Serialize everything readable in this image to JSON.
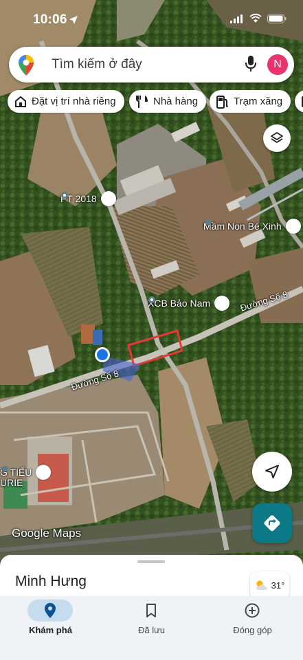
{
  "status_bar": {
    "time": "10:06"
  },
  "search": {
    "placeholder": "Tìm kiếm ở đây",
    "avatar_initial": "N"
  },
  "chips": [
    {
      "label": "Đặt vị trí nhà riêng",
      "icon": "home-icon"
    },
    {
      "label": "Nhà hàng",
      "icon": "restaurant-icon"
    },
    {
      "label": "Trạm xăng",
      "icon": "gas-station-icon"
    }
  ],
  "map": {
    "pois": [
      {
        "label": "PT 2018"
      },
      {
        "label": "Mầm Non Bé Xinh"
      },
      {
        "label": "XCB Bảo Nam"
      },
      {
        "label": "G TIỂU"
      },
      {
        "label": "URIE"
      }
    ],
    "roads": [
      {
        "label": "Đường Số 8"
      },
      {
        "label": "Đường Số 8"
      }
    ],
    "watermark": "Google Maps"
  },
  "sheet": {
    "place_name": "Minh Hưng",
    "temperature": "31°"
  },
  "nav": {
    "items": [
      {
        "label": "Khám phá",
        "icon": "explore-pin-icon",
        "active": true
      },
      {
        "label": "Đã lưu",
        "icon": "bookmark-icon",
        "active": false
      },
      {
        "label": "Đóng góp",
        "icon": "add-circle-icon",
        "active": false
      }
    ]
  }
}
